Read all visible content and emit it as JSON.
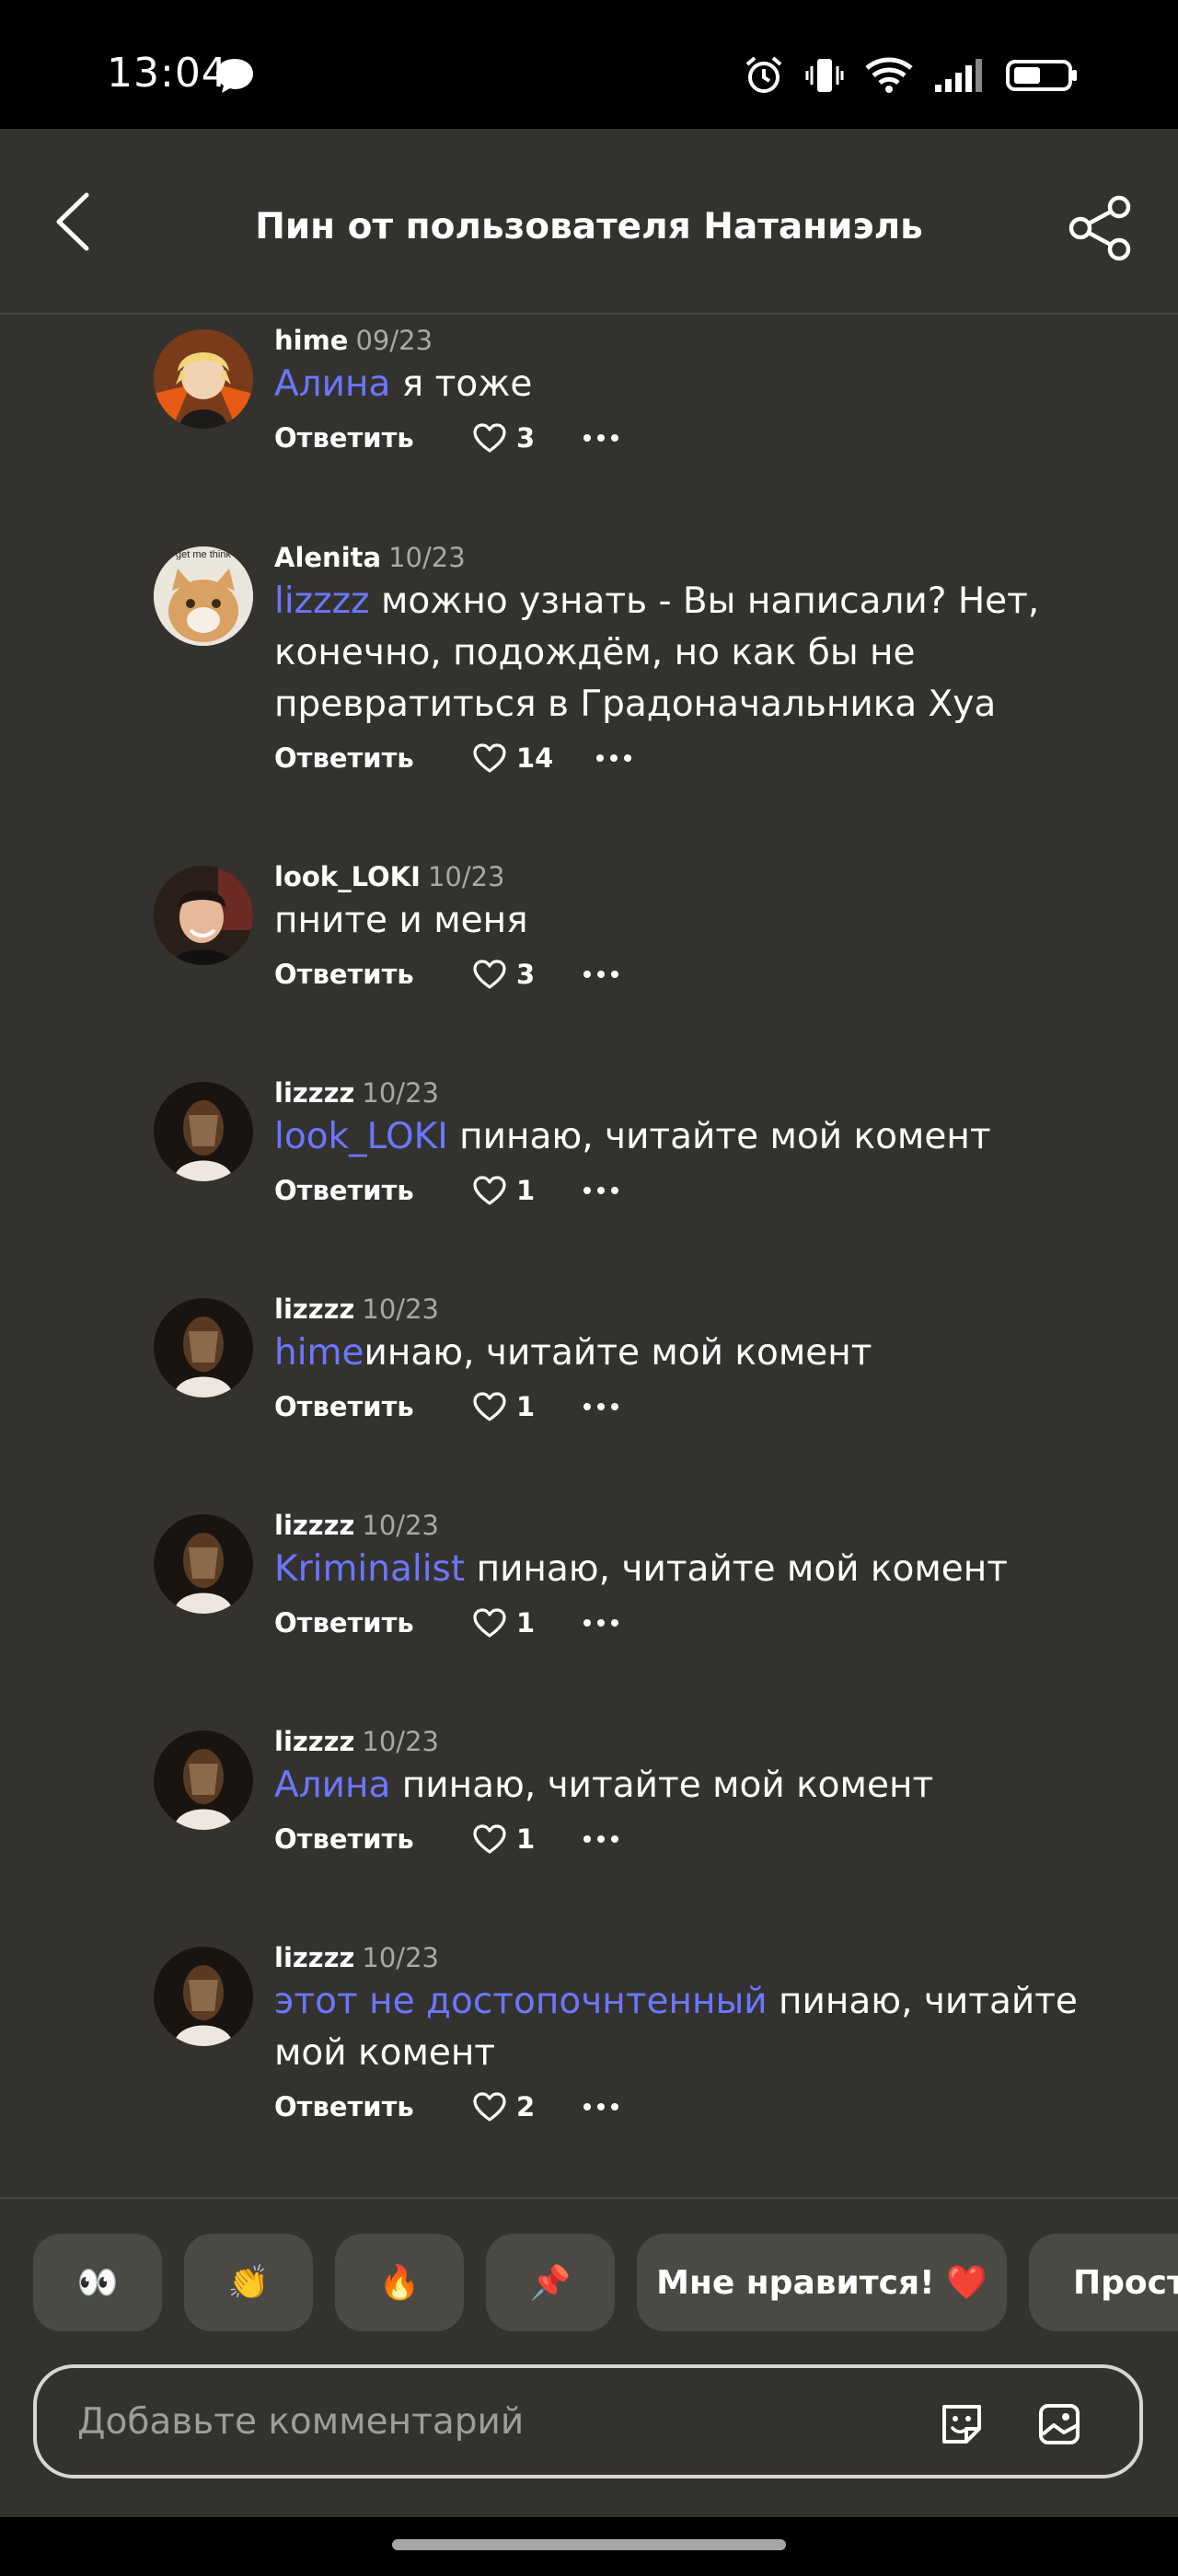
{
  "status_bar": {
    "time": "13:04",
    "icons": [
      "chat-bubble-icon",
      "alarm-icon",
      "vibrate-icon",
      "wifi-icon",
      "signal-icon",
      "battery-icon"
    ]
  },
  "header": {
    "title": "Пин от пользователя Натаниэль",
    "back_icon": "chevron-left-icon",
    "share_icon": "share-icon"
  },
  "reply_label": "Ответить",
  "comments": [
    {
      "author": "hime",
      "date": "09/23",
      "mention": "Алина",
      "text": " я тоже",
      "likes": "3"
    },
    {
      "author": "Alenita",
      "date": "10/23",
      "mention": "lizzzz",
      "text": " можно узнать - Вы написали? Нет, конечно, подождём, но как бы не превратиться в Градоначальника Хуа",
      "likes": "14"
    },
    {
      "author": "look_LOKI",
      "date": "10/23",
      "mention": "",
      "text": "пните и меня",
      "likes": "3"
    },
    {
      "author": "lizzzz",
      "date": "10/23",
      "mention": "look_LOKI",
      "text": " пинаю, читайте мой комент",
      "likes": "1"
    },
    {
      "author": "lizzzz",
      "date": "10/23",
      "mention": "hime",
      "text": "инаю, читайте мой комент",
      "likes": "1"
    },
    {
      "author": "lizzzz",
      "date": "10/23",
      "mention": "Kriminalist",
      "text": " пинаю, читайте мой комент",
      "likes": "1"
    },
    {
      "author": "lizzzz",
      "date": "10/23",
      "mention": "Алина",
      "text": " пинаю, читайте мой комент",
      "likes": "1"
    },
    {
      "author": "lizzzz",
      "date": "10/23",
      "mention": "этот не достопочнтенный",
      "text": " пинаю, читайте мой комент",
      "likes": "2"
    }
  ],
  "avatar_text": "get me think",
  "reactions": [
    "👀",
    "👏",
    "🔥",
    "📌",
    "Мне нравится! ❤️",
    "Просто"
  ],
  "comment_input": {
    "placeholder": "Добавьте комментарий",
    "sticker_icon": "sticker-icon",
    "image_icon": "image-icon"
  },
  "colors": {
    "background": "#33322f",
    "mention": "#6b77ff",
    "chip": "#4a4944"
  }
}
